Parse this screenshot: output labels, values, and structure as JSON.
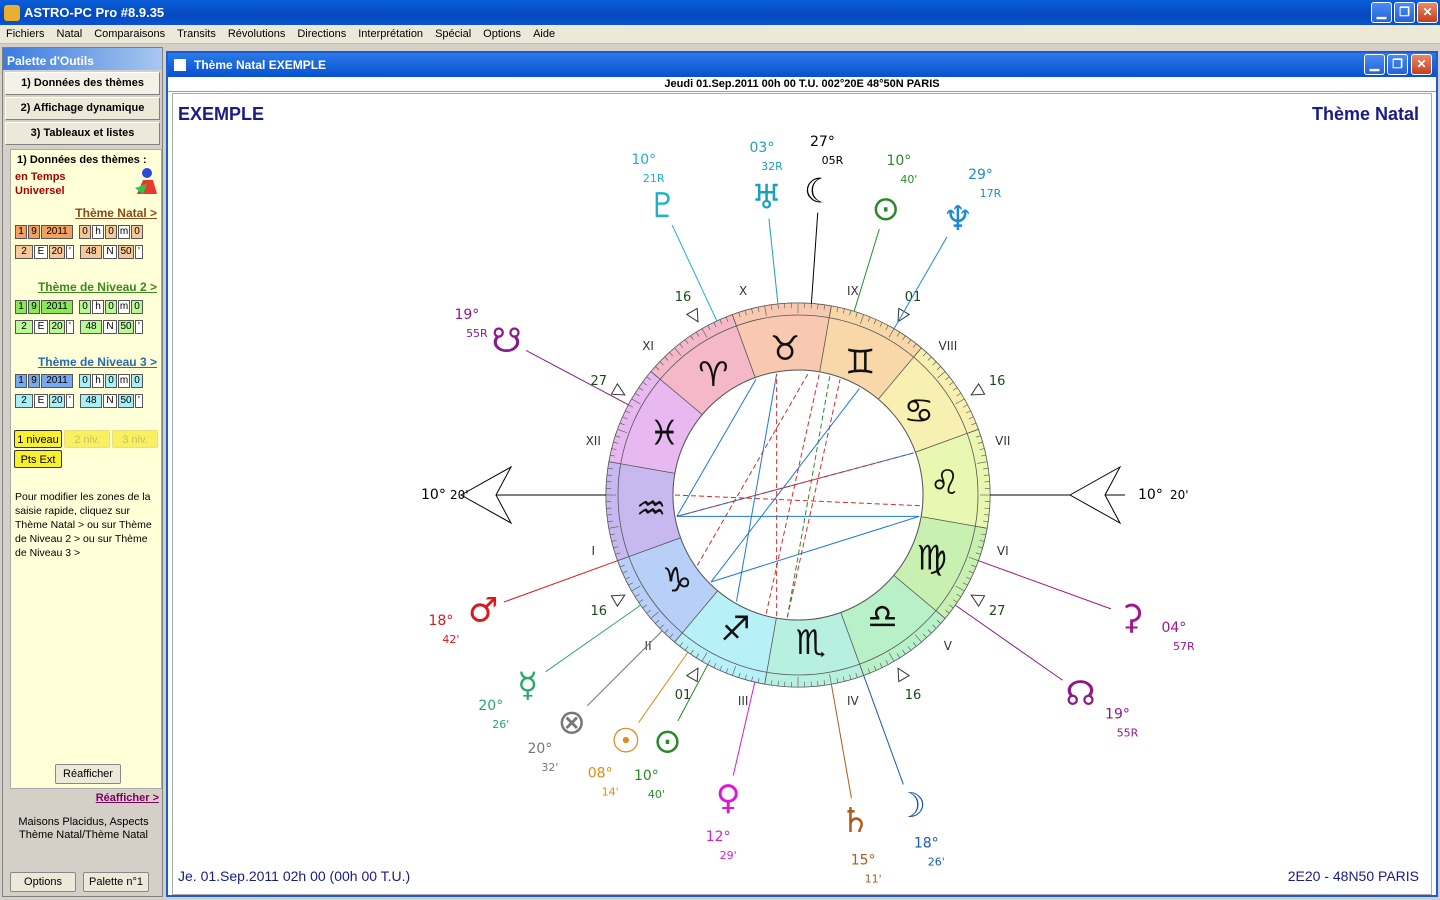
{
  "window": {
    "title": "ASTRO-PC Pro #8.9.35"
  },
  "menu": [
    "Fichiers",
    "Natal",
    "Comparaisons",
    "Transits",
    "Révolutions",
    "Directions",
    "Interprétation",
    "Spécial",
    "Options",
    "Aide"
  ],
  "palette": {
    "title": "Palette d'Outils",
    "tabs": [
      "1) Données des thèmes",
      "2) Affichage dynamique",
      "3) Tableaux et listes"
    ],
    "section_title": "1) Données des thèmes :",
    "time_mode": "en Temps\nUniversel",
    "levels": [
      {
        "link": "Thème Natal >",
        "date": [
          "1",
          "9",
          "2011"
        ],
        "time": [
          "0",
          "h",
          "0",
          "m",
          "0"
        ],
        "lon": [
          "2",
          "E",
          "20",
          "'"
        ],
        "lat": [
          "48",
          "N",
          "50",
          "'"
        ]
      },
      {
        "link": "Thème de Niveau 2 >",
        "date": [
          "1",
          "9",
          "2011"
        ],
        "time": [
          "0",
          "h",
          "0",
          "m",
          "0"
        ],
        "lon": [
          "2",
          "E",
          "20",
          "'"
        ],
        "lat": [
          "48",
          "N",
          "50",
          "'"
        ]
      },
      {
        "link": "Thème de Niveau 3 >",
        "date": [
          "1",
          "9",
          "2011"
        ],
        "time": [
          "0",
          "h",
          "0",
          "m",
          "0"
        ],
        "lon": [
          "2",
          "E",
          "20",
          "'"
        ],
        "lat": [
          "48",
          "N",
          "50",
          "'"
        ]
      }
    ],
    "level_buttons": [
      "1 niveau",
      "2 niv.",
      "3 niv."
    ],
    "pts_ext": "Pts Ext",
    "help": "Pour modifier les zones de la saisie rapide, cliquez sur Thème Natal > ou sur Thème de Niveau 2 > ou sur Thème de Niveau 3 >",
    "refresh_button": "Réafficher",
    "refresh_link": "Réafficher >",
    "footer_note": "Maisons Placidus, Aspects\nThème Natal/Thème Natal",
    "options_button": "Options",
    "palette_button": "Palette n°1"
  },
  "chart_window": {
    "title": "Thème Natal  EXEMPLE",
    "subtitle": "Jeudi 01.Sep.2011 00h 00 T.U. 002°20E 48°50N  PARIS",
    "name": "EXEMPLE",
    "kind": "Thème Natal",
    "footer_left": "Je. 01.Sep.2011 02h 00 (00h 00 T.U.)",
    "footer_right": "2E20 - 48N50  PARIS"
  },
  "wheel": {
    "asc_left": {
      "deg": "10°",
      "min": "20'"
    },
    "asc_right": {
      "deg": "10°",
      "min": "20'"
    },
    "houses": [
      "I",
      "II",
      "III",
      "IV",
      "V",
      "VI",
      "VII",
      "VIII",
      "IX",
      "X",
      "XI",
      "XII"
    ],
    "cusp_labels": [
      "27",
      "16",
      "01",
      "16",
      "27",
      "16",
      "01",
      "16"
    ],
    "signs": [
      "♈",
      "♉",
      "♊",
      "♋",
      "♌",
      "♍",
      "♎",
      "♏",
      "♐",
      "♑",
      "♒",
      "♓"
    ],
    "planets": [
      {
        "glyph": "♅",
        "deg": "03°",
        "min": "32R",
        "color": "#1a9fbf"
      },
      {
        "glyph": "☾",
        "deg": "27°",
        "min": "05R",
        "color": "#000000"
      },
      {
        "glyph": "♇",
        "deg": "10°",
        "min": "21R",
        "color": "#1ab3c9"
      },
      {
        "glyph": "⊙",
        "deg": "10°",
        "min": "40'",
        "color": "#2a8a2a"
      },
      {
        "glyph": "♆",
        "deg": "29°",
        "min": "17R",
        "color": "#1a8ad8"
      },
      {
        "glyph": "☋",
        "deg": "19°",
        "min": "55R",
        "color": "#8a1a8a"
      },
      {
        "glyph": "♂",
        "deg": "18°",
        "min": "42'",
        "color": "#d81a1a"
      },
      {
        "glyph": "⚳",
        "deg": "04°",
        "min": "57R",
        "color": "#a0168a"
      },
      {
        "glyph": "☊",
        "deg": "19°",
        "min": "55R",
        "color": "#8a1a8a"
      },
      {
        "glyph": "☿",
        "deg": "20°",
        "min": "26'",
        "color": "#2aa86a"
      },
      {
        "glyph": "⊗",
        "deg": "20°",
        "min": "32'",
        "color": "#777777"
      },
      {
        "glyph": "☉",
        "deg": "08°",
        "min": "14'",
        "color": "#e08a1a"
      },
      {
        "glyph": "⊙",
        "deg": "10°",
        "min": "40'",
        "color": "#2a8a2a"
      },
      {
        "glyph": "♀",
        "deg": "12°",
        "min": "29'",
        "color": "#d81ad8"
      },
      {
        "glyph": "♄",
        "deg": "15°",
        "min": "11'",
        "color": "#b05a1a"
      },
      {
        "glyph": "☽",
        "deg": "18°",
        "min": "26'",
        "color": "#1a5ab0"
      }
    ]
  }
}
